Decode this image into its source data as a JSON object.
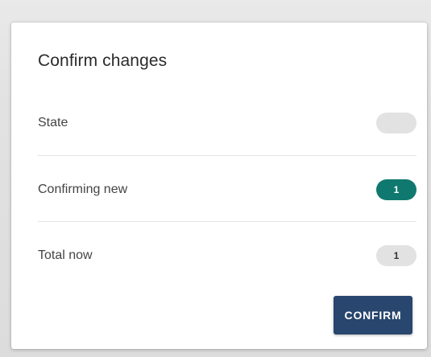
{
  "dialog": {
    "title": "Confirm changes",
    "rows": [
      {
        "label": "State",
        "badge": ""
      },
      {
        "label": "Confirming new",
        "badge": "1"
      },
      {
        "label": "Total now",
        "badge": "1"
      }
    ],
    "confirm_label": "CONFIRM"
  },
  "colors": {
    "confirming_badge": "#10796f",
    "neutral_badge": "#e2e2e2",
    "confirm_button": "#28466e"
  }
}
